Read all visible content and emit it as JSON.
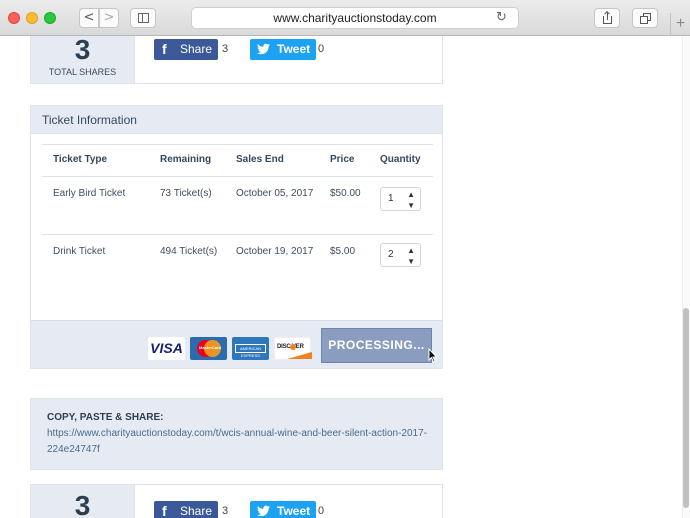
{
  "browser": {
    "url": "www.charityauctionstoday.com",
    "back_glyph": "<",
    "forward_glyph": ">",
    "reload_glyph": "↻",
    "newtab_glyph": "+"
  },
  "share_top": {
    "count": "3",
    "count_label": "TOTAL SHARES",
    "facebook_icon": "f",
    "facebook_label": "Share",
    "facebook_count": "3",
    "twitter_label": "Tweet",
    "twitter_count": "0"
  },
  "tickets": {
    "heading": "Ticket Information",
    "columns": [
      "Ticket Type",
      "Remaining",
      "Sales End",
      "Price",
      "Quantity"
    ],
    "rows": [
      {
        "type": "Early Bird Ticket",
        "remaining": "73 Ticket(s)",
        "sales_end": "October 05, 2017",
        "price": "$50.00",
        "quantity": "1"
      },
      {
        "type": "Drink Ticket",
        "remaining": "494 Ticket(s)",
        "sales_end": "October 19, 2017",
        "price": "$5.00",
        "quantity": "2"
      }
    ],
    "qty_arrows": "▲▼",
    "cards": {
      "visa": "VISA",
      "mastercard": "MasterCard",
      "amex": "AMERICAN EXPRESS",
      "discover": "DISC VER"
    },
    "button_label": "PROCESSING..."
  },
  "copy_share": {
    "title": "COPY, PASTE & SHARE:",
    "url": "https://www.charityauctionstoday.com/t/wcis-annual-wine-and-beer-silent-action-2017-224e24747f"
  },
  "share_bottom": {
    "count": "3",
    "facebook_icon": "f",
    "facebook_label": "Share",
    "facebook_count": "3",
    "twitter_label": "Tweet",
    "twitter_count": "0"
  }
}
